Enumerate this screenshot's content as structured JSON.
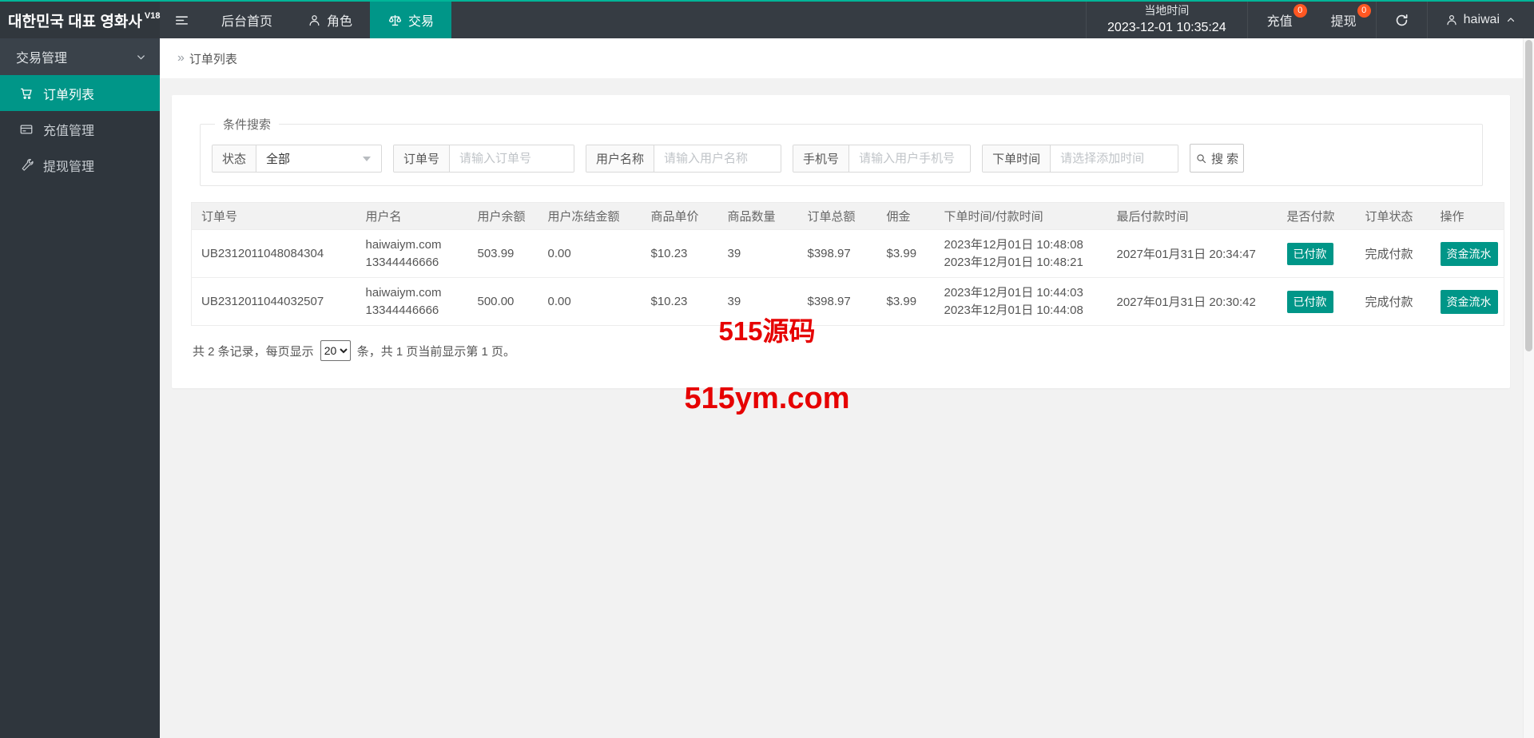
{
  "colors": {
    "accent": "#009688",
    "top-line": "#00b598",
    "badge": "#ff5722",
    "watermark": "#e60000"
  },
  "topbar": {
    "logo": "대한민국 대표 영화사",
    "logo_version": "V18",
    "nav": [
      {
        "label": "后台首页",
        "icon": "none",
        "active": false
      },
      {
        "label": "角色",
        "icon": "person-icon",
        "active": false
      },
      {
        "label": "交易",
        "icon": "scales-icon",
        "active": true
      }
    ],
    "time": {
      "label": "当地时间",
      "value": "2023-12-01 10:35:24"
    },
    "recharge": {
      "label": "充值",
      "badge": "0"
    },
    "withdraw": {
      "label": "提现",
      "badge": "0"
    },
    "refresh_icon": "refresh-icon",
    "user": {
      "name": "haiwai",
      "icon": "person-icon",
      "chevron": "chevron-up-icon"
    }
  },
  "sidebar": {
    "group": {
      "label": "交易管理",
      "chevron": "chevron-down-icon"
    },
    "items": [
      {
        "label": "订单列表",
        "icon": "cart-icon",
        "active": true
      },
      {
        "label": "充值管理",
        "icon": "card-icon",
        "active": false
      },
      {
        "label": "提现管理",
        "icon": "wrench-icon",
        "active": false
      }
    ]
  },
  "breadcrumb": {
    "arrow": "»",
    "label": "订单列表"
  },
  "search": {
    "legend": "条件搜索",
    "status": {
      "label": "状态",
      "value": "全部"
    },
    "fields": [
      {
        "label": "订单号",
        "placeholder": "请输入订单号"
      },
      {
        "label": "用户名称",
        "placeholder": "请输入用户名称"
      },
      {
        "label": "手机号",
        "placeholder": "请输入用户手机号"
      },
      {
        "label": "下单时间",
        "placeholder": "请选择添加时间"
      }
    ],
    "button_label": "搜 索",
    "button_icon": "search-icon"
  },
  "table": {
    "headers": [
      "订单号",
      "用户名",
      "用户余额",
      "用户冻结金额",
      "商品单价",
      "商品数量",
      "订单总额",
      "佣金",
      "下单时间/付款时间",
      "最后付款时间",
      "是否付款",
      "订单状态",
      "操作"
    ],
    "rows": [
      {
        "order_no": "UB2312011048084304",
        "user_line1": "haiwaiym.com",
        "user_line2": "13344446666",
        "balance": "503.99",
        "frozen": "0.00",
        "unit_price": "$10.23",
        "qty": "39",
        "total": "$398.97",
        "commission": "$3.99",
        "order_time": "2023年12月01日 10:48:08",
        "pay_time": "2023年12月01日 10:48:21",
        "last_pay_time": "2027年01月31日 20:34:47",
        "paid_label": "已付款",
        "status_label": "完成付款",
        "action_label": "资金流水"
      },
      {
        "order_no": "UB2312011044032507",
        "user_line1": "haiwaiym.com",
        "user_line2": "13344446666",
        "balance": "500.00",
        "frozen": "0.00",
        "unit_price": "$10.23",
        "qty": "39",
        "total": "$398.97",
        "commission": "$3.99",
        "order_time": "2023年12月01日 10:44:03",
        "pay_time": "2023年12月01日 10:44:08",
        "last_pay_time": "2027年01月31日 20:30:42",
        "paid_label": "已付款",
        "status_label": "完成付款",
        "action_label": "资金流水"
      }
    ]
  },
  "pagination": {
    "prefix": "共 2 条记录，每页显示",
    "page_size": "20",
    "suffix": "条，共 1 页当前显示第 1 页。"
  },
  "watermark": {
    "line1": "515源码",
    "line2": "515ym.com"
  }
}
